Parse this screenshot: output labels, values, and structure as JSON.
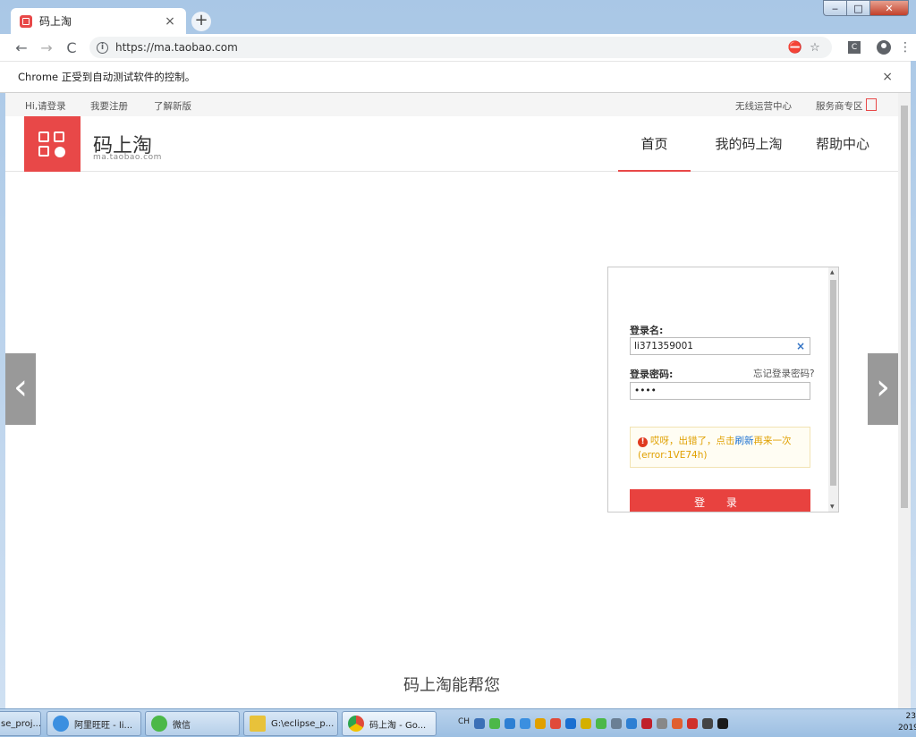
{
  "window": {
    "tab_title": "码上淘",
    "tab_close": "×",
    "new_tab": "+",
    "min": "‒",
    "max": "□",
    "close": "✕"
  },
  "toolbar": {
    "back": "←",
    "forward": "→",
    "reload": "C",
    "info_icon": "i",
    "url": "https://ma.taobao.com",
    "ext_label": "C"
  },
  "infobar": {
    "text": "Chrome 正受到自动测试软件的控制。",
    "close": "×"
  },
  "topbar": {
    "login": "Hi,请登录",
    "register": "我要注册",
    "new_version": "了解新版",
    "wireless": "无线运营中心",
    "service": "服务商专区"
  },
  "header": {
    "brand_name": "码上淘",
    "brand_domain": "ma.taobao.com",
    "nav": [
      "首页",
      "我的码上淘",
      "帮助中心"
    ]
  },
  "carousel": {
    "prev": "‹",
    "next": "›"
  },
  "login": {
    "username_label": "登录名:",
    "username_value": "li371359001",
    "clear": "×",
    "password_label": "登录密码:",
    "password_value": "••••",
    "forgot": "忘记登录密码?",
    "error_icon": "!",
    "error_prefix": "哎呀，出错了，点击",
    "error_link": "刷新",
    "error_suffix": "再来一次",
    "error_code": "(error:1VE74h)",
    "submit": "登 录"
  },
  "help_heading": "码上淘能帮您",
  "taskbar": {
    "items": [
      {
        "label": "se_proj...",
        "color": "#5a6b7c"
      },
      {
        "label": "阿里旺旺 - li...",
        "color": "#3b8fe0"
      },
      {
        "label": "微信",
        "color": "#4cb848"
      },
      {
        "label": "G:\\eclipse_p...",
        "color": "#e8c23a"
      },
      {
        "label": "码上淘 - Go...",
        "color": "#e04a3a"
      }
    ],
    "ime": "CH",
    "clock_time": "23",
    "clock_date": "2019"
  }
}
